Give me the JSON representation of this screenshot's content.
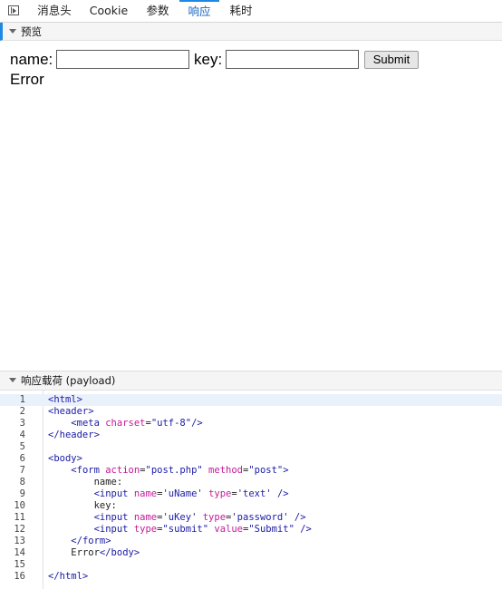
{
  "tabs": [
    {
      "label": "消息头",
      "active": false
    },
    {
      "label": "Cookie",
      "active": false
    },
    {
      "label": "参数",
      "active": false
    },
    {
      "label": "响应",
      "active": true
    },
    {
      "label": "耗时",
      "active": false
    }
  ],
  "preview_section": {
    "title": "预览"
  },
  "preview": {
    "name_label": "name:",
    "name_value": "",
    "key_label": "key:",
    "key_value": "",
    "submit_label": "Submit",
    "error_text": "Error"
  },
  "payload_section": {
    "title": "响应载荷 (payload)"
  },
  "code_lines": [
    {
      "n": "1",
      "indent": "",
      "parts": [
        [
          "t",
          "<html>"
        ]
      ]
    },
    {
      "n": "2",
      "indent": "",
      "parts": [
        [
          "t",
          "<header>"
        ]
      ]
    },
    {
      "n": "3",
      "indent": "    ",
      "parts": [
        [
          "t",
          "<meta "
        ],
        [
          "a",
          "charset"
        ],
        [
          "x",
          "="
        ],
        [
          "v",
          "\"utf-8\""
        ],
        [
          "t",
          "/>"
        ]
      ]
    },
    {
      "n": "4",
      "indent": "",
      "parts": [
        [
          "t",
          "</header>"
        ]
      ]
    },
    {
      "n": "5",
      "indent": "",
      "parts": []
    },
    {
      "n": "6",
      "indent": "",
      "parts": [
        [
          "t",
          "<body>"
        ]
      ]
    },
    {
      "n": "7",
      "indent": "    ",
      "parts": [
        [
          "t",
          "<form "
        ],
        [
          "a",
          "action"
        ],
        [
          "x",
          "="
        ],
        [
          "v",
          "\"post.php\""
        ],
        [
          "x",
          " "
        ],
        [
          "a",
          "method"
        ],
        [
          "x",
          "="
        ],
        [
          "v",
          "\"post\""
        ],
        [
          "t",
          ">"
        ]
      ]
    },
    {
      "n": "8",
      "indent": "        ",
      "parts": [
        [
          "x",
          "name:"
        ]
      ]
    },
    {
      "n": "9",
      "indent": "        ",
      "parts": [
        [
          "t",
          "<input "
        ],
        [
          "a",
          "name"
        ],
        [
          "x",
          "="
        ],
        [
          "v",
          "'uName'"
        ],
        [
          "x",
          " "
        ],
        [
          "a",
          "type"
        ],
        [
          "x",
          "="
        ],
        [
          "v",
          "'text'"
        ],
        [
          "t",
          " />"
        ]
      ]
    },
    {
      "n": "10",
      "indent": "        ",
      "parts": [
        [
          "x",
          "key:"
        ]
      ]
    },
    {
      "n": "11",
      "indent": "        ",
      "parts": [
        [
          "t",
          "<input "
        ],
        [
          "a",
          "name"
        ],
        [
          "x",
          "="
        ],
        [
          "v",
          "'uKey'"
        ],
        [
          "x",
          " "
        ],
        [
          "a",
          "type"
        ],
        [
          "x",
          "="
        ],
        [
          "v",
          "'password'"
        ],
        [
          "t",
          " />"
        ]
      ]
    },
    {
      "n": "12",
      "indent": "        ",
      "parts": [
        [
          "t",
          "<input "
        ],
        [
          "a",
          "type"
        ],
        [
          "x",
          "="
        ],
        [
          "v",
          "\"submit\""
        ],
        [
          "x",
          " "
        ],
        [
          "a",
          "value"
        ],
        [
          "x",
          "="
        ],
        [
          "v",
          "\"Submit\""
        ],
        [
          "t",
          " />"
        ]
      ]
    },
    {
      "n": "13",
      "indent": "    ",
      "parts": [
        [
          "t",
          "</form>"
        ]
      ]
    },
    {
      "n": "14",
      "indent": "    ",
      "parts": [
        [
          "x",
          "Error"
        ],
        [
          "t",
          "</body>"
        ]
      ]
    },
    {
      "n": "15",
      "indent": "",
      "parts": []
    },
    {
      "n": "16",
      "indent": "",
      "parts": [
        [
          "t",
          "</html>"
        ]
      ]
    }
  ],
  "highlighted_line": "1",
  "colors": {
    "accent": "#1e88e5",
    "tag": "#1a1aa6",
    "attr": "#c41a9a",
    "highlight": "#e9f1fb"
  }
}
